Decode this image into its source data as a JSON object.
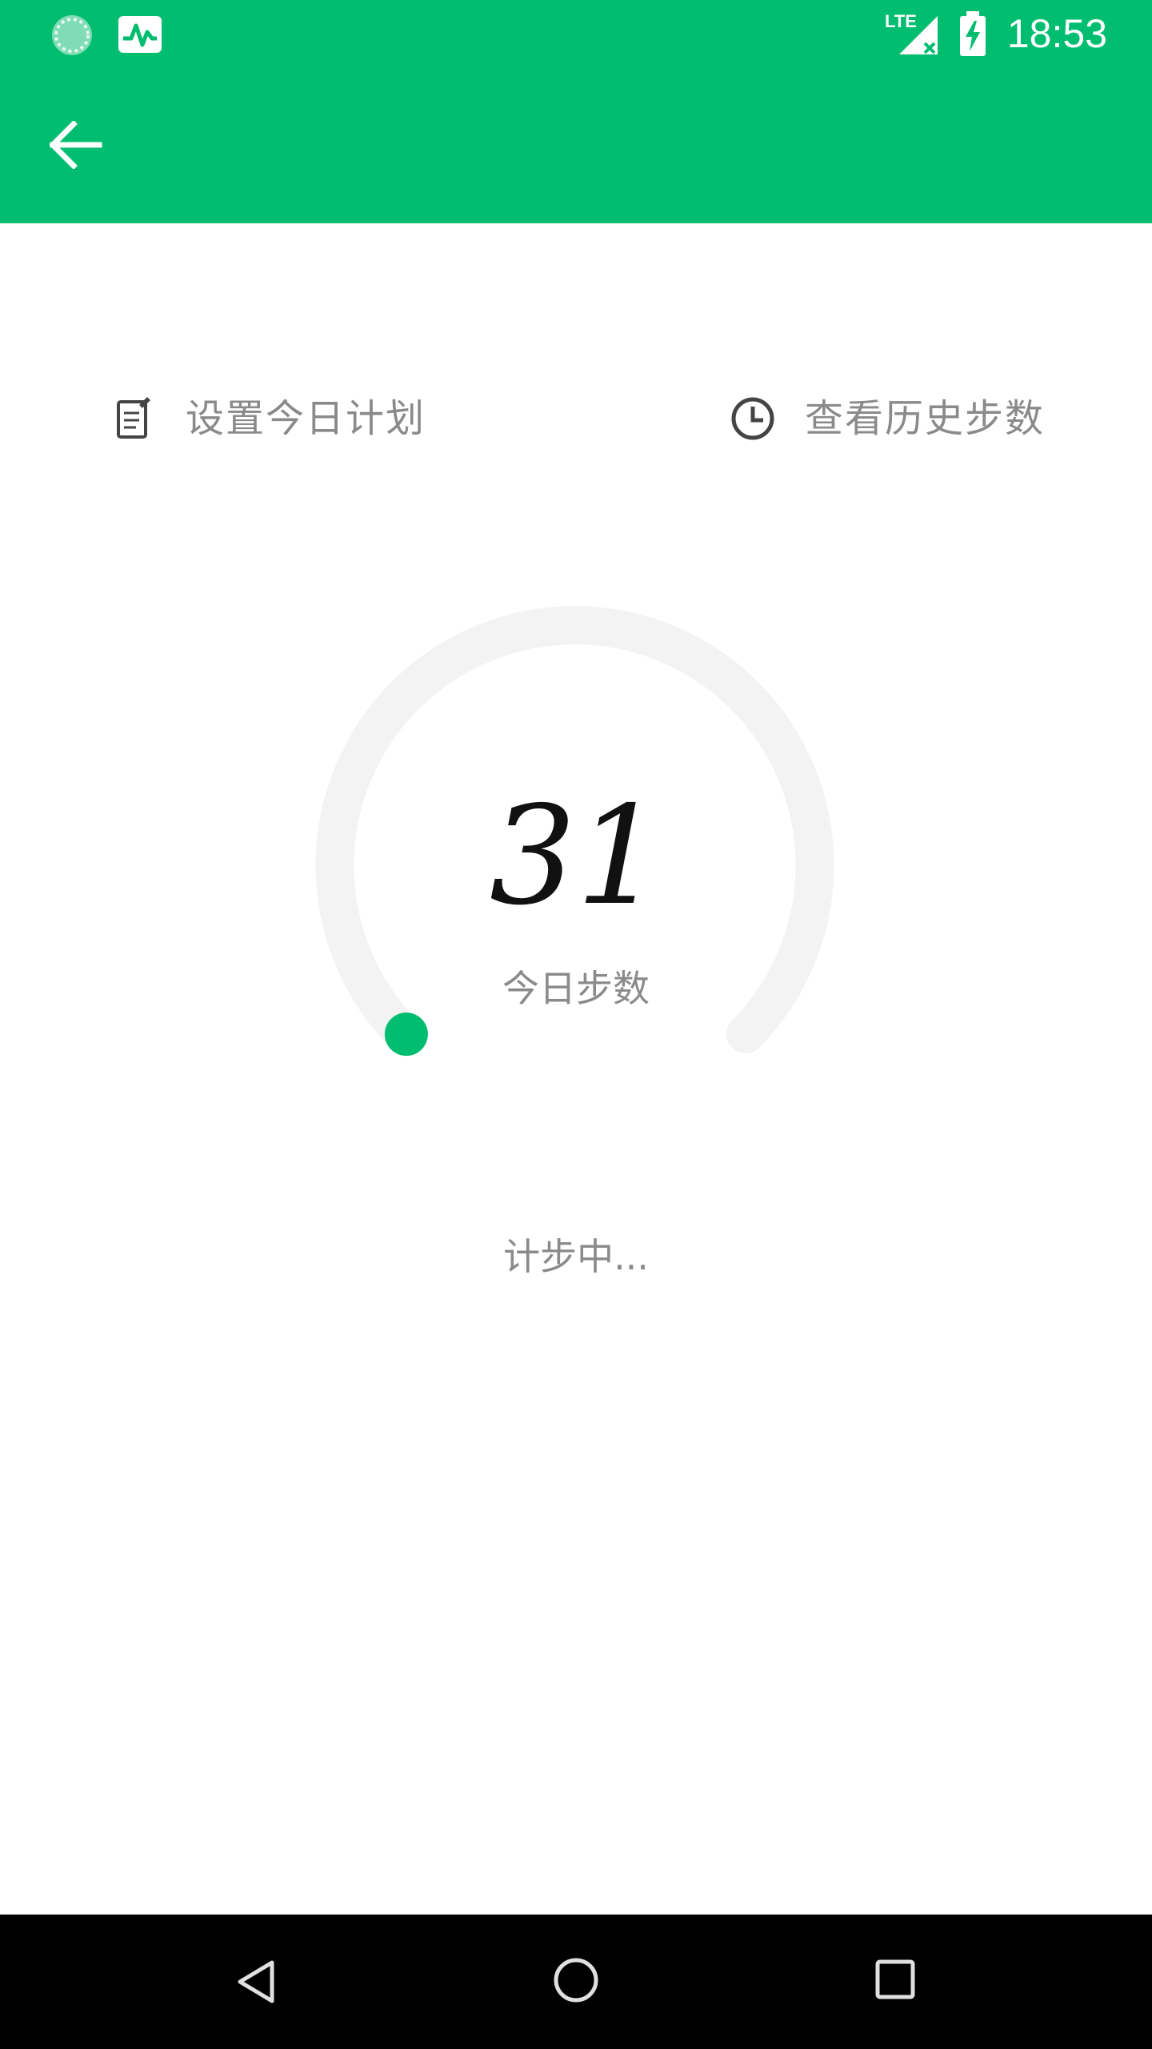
{
  "status_bar": {
    "time": "18:53",
    "network_label": "LTE",
    "left_icons": [
      "loading-icon",
      "activity-icon"
    ],
    "right_icons": [
      "signal-icon",
      "battery-charging-icon"
    ]
  },
  "toolbar": {
    "back_icon": "arrow-back-icon"
  },
  "actions": {
    "set_plan_label": "设置今日计划",
    "set_plan_icon": "note-edit-icon",
    "history_label": "查看历史步数",
    "history_icon": "clock-icon"
  },
  "progress": {
    "steps": "31",
    "caption": "今日步数",
    "fraction": 0.0
  },
  "status_text": "计步中...",
  "colors": {
    "accent": "#00bd6f",
    "track": "#f3f3f3",
    "secondary_text": "#8a8a8a"
  },
  "nav_bar": {
    "icons": [
      "back-triangle-icon",
      "home-circle-icon",
      "recents-square-icon"
    ]
  }
}
